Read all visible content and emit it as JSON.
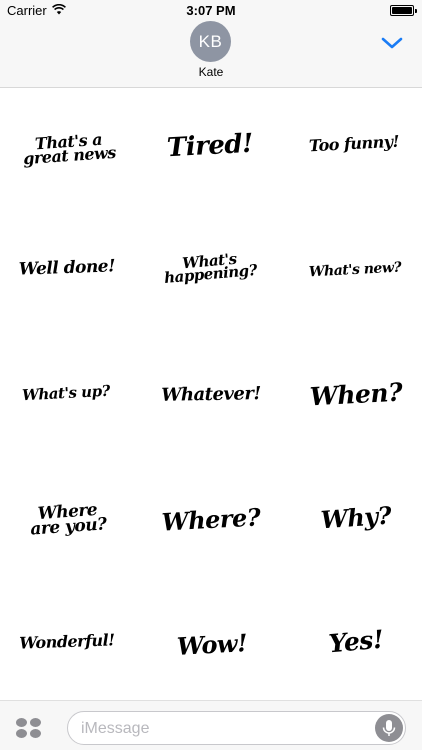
{
  "status_bar": {
    "carrier": "Carrier",
    "time": "3:07 PM"
  },
  "contact": {
    "initials": "KB",
    "name": "Kate"
  },
  "stickers": [
    {
      "text": "That's a\ngreat news"
    },
    {
      "text": "Tired!"
    },
    {
      "text": "Too funny!"
    },
    {
      "text": "Well done!"
    },
    {
      "text": "What's\nhappening?"
    },
    {
      "text": "What's new?"
    },
    {
      "text": "What's up?"
    },
    {
      "text": "Whatever!"
    },
    {
      "text": "When?"
    },
    {
      "text": "Where\nare you?"
    },
    {
      "text": "Where?"
    },
    {
      "text": "Why?"
    },
    {
      "text": "Wonderful!"
    },
    {
      "text": "Wow!"
    },
    {
      "text": "Yes!"
    }
  ],
  "compose": {
    "placeholder": "iMessage"
  },
  "colors": {
    "header_bg": "#f7f7f7",
    "accent": "#1a7cf5",
    "avatar_bg": "#8e95a3"
  },
  "icons": {
    "wifi": "wifi-icon",
    "battery": "battery-icon",
    "chevron": "chevron-down-icon",
    "apps": "app-drawer-icon",
    "mic": "microphone-icon"
  }
}
